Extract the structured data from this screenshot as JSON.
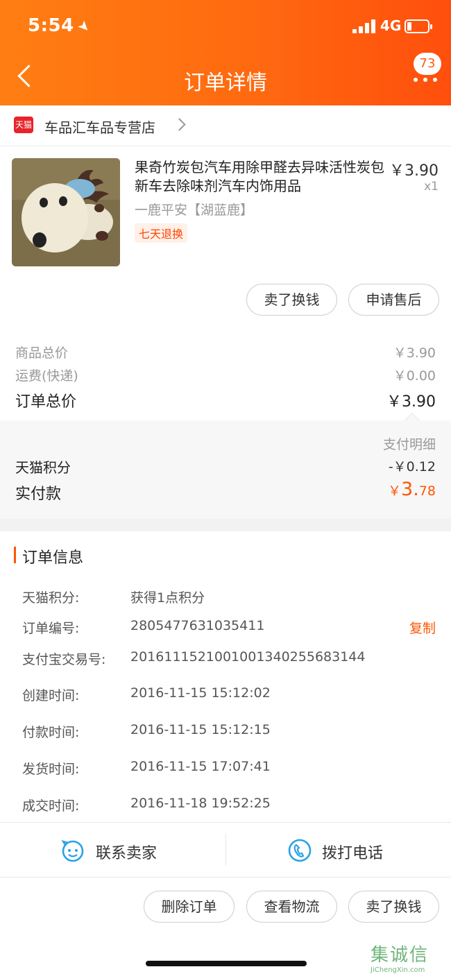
{
  "status_bar": {
    "time": "5:54",
    "network": "4G"
  },
  "header": {
    "title": "订单详情",
    "badge_count": "73"
  },
  "shop": {
    "icon_label": "天猫",
    "name": "车品汇车品专营店"
  },
  "product": {
    "title": "果奇竹炭包汽车用除甲醛去异味活性炭包新车去除味剂汽车内饰用品",
    "spec": "一鹿平安【湖蓝鹿】",
    "tag": "七天退换",
    "price": "￥3.90",
    "quantity": "x1"
  },
  "item_actions": {
    "sell_label": "卖了换钱",
    "after_sale_label": "申请售后"
  },
  "summary": {
    "goods_total_label": "商品总价",
    "goods_total_value": "￥3.90",
    "shipping_label": "运费(快递)",
    "shipping_value": "￥0.00",
    "order_total_label": "订单总价",
    "order_total_value": "￥3.90",
    "pay_detail_label": "支付明细",
    "points_label": "天猫积分",
    "points_value": "-￥0.12",
    "paid_label": "实付款",
    "paid_symbol": "￥",
    "paid_int": "3.",
    "paid_dec": "78"
  },
  "order_info": {
    "title": "订单信息",
    "rows": [
      {
        "key": "天猫积分:",
        "value": "获得1点积分"
      },
      {
        "key": "订单编号:",
        "value": "2805477631035411"
      },
      {
        "key": "支付宝交易号:",
        "value": "2016111521001001340255683144"
      },
      {
        "key": "创建时间:",
        "value": "2016-11-15 15:12:02"
      },
      {
        "key": "付款时间:",
        "value": "2016-11-15 15:12:15"
      },
      {
        "key": "发货时间:",
        "value": "2016-11-15 17:07:41"
      },
      {
        "key": "成交时间:",
        "value": "2016-11-18 19:52:25"
      }
    ],
    "copy_label": "复制"
  },
  "contact": {
    "seller_label": "联系卖家",
    "phone_label": "拨打电话"
  },
  "bottom_actions": {
    "delete_label": "删除订单",
    "logistics_label": "查看物流",
    "sell_label": "卖了换钱"
  },
  "watermark": {
    "brand": "集诚信",
    "url": "JiChengXin.com"
  },
  "colors": {
    "header_orange": "#ff6a10",
    "accent": "#ff5500",
    "tmall_red": "#e8232a",
    "icon_blue": "#29a1e6"
  },
  "icons": [
    "back-icon",
    "more-icon",
    "tmall-icon",
    "chevron-right-icon",
    "chat-face-icon",
    "phone-icon"
  ]
}
